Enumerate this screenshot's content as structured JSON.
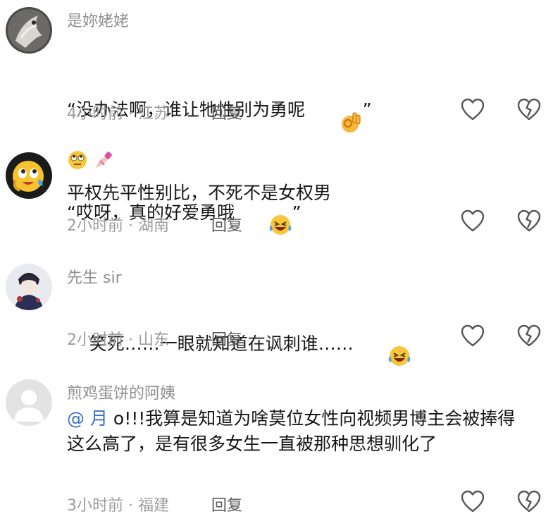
{
  "comments": [
    {
      "username": "是妳姥姥",
      "lines": [
        "“没办法啊，谁让牠性别为勇呢",
        "“哎呀，真的好爱勇哦"
      ],
      "line_suffixes": [
        "”",
        "”"
      ],
      "line_emojis": [
        "ok-hand-emoji",
        "laughing-tears-emoji"
      ],
      "time": "4小时前",
      "location": "江苏",
      "reply_label": "回复"
    },
    {
      "username_emojis": [
        "eye-roll-emoji",
        "nail-polish-emoji"
      ],
      "text": "平权先平性别比，不死不是女权男",
      "time": "2小时前",
      "location": "湖南",
      "reply_label": "回复"
    },
    {
      "username": "先生 sir",
      "text": "笑死……一眼就知道在讽刺谁……",
      "text_emoji": "laughing-tears-emoji",
      "time": "2小时前",
      "location": "山东",
      "reply_label": "回复"
    },
    {
      "username": "煎鸡蛋饼的阿姨",
      "mention": "@ 月",
      "text_after_mention": " o!!!我算是知道为啥莫位女性向视频男博主会被捧得这么高了，是有很多女生一直被那种思想驯化了",
      "time": "3小时前",
      "location": "福建",
      "reply_label": "回复"
    }
  ],
  "meta_separator": " · ",
  "colors": {
    "meta": "#9c9c9c",
    "mention": "#3a6fc4",
    "username": "#8f8f8f"
  }
}
